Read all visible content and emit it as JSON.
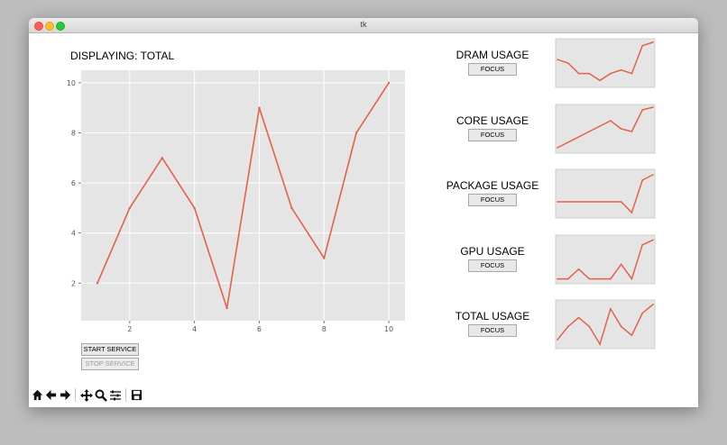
{
  "window": {
    "title": "tk"
  },
  "main": {
    "heading": "DISPLAYING: TOTAL",
    "start_button": "START SERVICE",
    "stop_button": "STOP SERVICE"
  },
  "panels": [
    {
      "label": "DRAM USAGE",
      "button": "FOCUS"
    },
    {
      "label": "CORE USAGE",
      "button": "FOCUS"
    },
    {
      "label": "PACKAGE USAGE",
      "button": "FOCUS"
    },
    {
      "label": "GPU USAGE",
      "button": "FOCUS"
    },
    {
      "label": "TOTAL USAGE",
      "button": "FOCUS"
    }
  ],
  "toolbar": [
    "home-icon",
    "back-arrow-icon",
    "forward-arrow-icon",
    "pan-icon",
    "zoom-icon",
    "configure-icon",
    "save-icon"
  ],
  "colors": {
    "line": "#e2634a",
    "plot_bg": "#e5e5e5",
    "grid": "#ffffff"
  },
  "chart_data": [
    {
      "type": "line",
      "x": [
        1,
        2,
        3,
        4,
        5,
        6,
        7,
        8,
        9,
        10
      ],
      "series": [
        {
          "values": [
            2,
            5,
            7,
            5,
            1,
            9,
            5,
            3,
            8,
            10
          ]
        }
      ],
      "xticks": [
        2,
        4,
        6,
        8,
        10
      ],
      "yticks": [
        2,
        4,
        6,
        8,
        10
      ],
      "xlim": [
        0.5,
        10.5
      ],
      "ylim": [
        0.5,
        10.5
      ],
      "grid": true
    },
    {
      "type": "line",
      "panel": "DRAM USAGE",
      "x": [
        1,
        2,
        3,
        4,
        5,
        6,
        7,
        8,
        9,
        10
      ],
      "series": [
        {
          "values": [
            6,
            5.5,
            4,
            4,
            3,
            4,
            4.5,
            4,
            8,
            8.5
          ]
        }
      ],
      "ylim": [
        2,
        9
      ]
    },
    {
      "type": "line",
      "panel": "CORE USAGE",
      "x": [
        1,
        2,
        3,
        4,
        5,
        6,
        7,
        8,
        9,
        10
      ],
      "series": [
        {
          "values": [
            1,
            2,
            3,
            4,
            5,
            6,
            4.5,
            4,
            8,
            8.5
          ]
        }
      ],
      "ylim": [
        0,
        9
      ]
    },
    {
      "type": "line",
      "panel": "PACKAGE USAGE",
      "x": [
        1,
        2,
        3,
        4,
        5,
        6,
        7,
        8,
        9,
        10
      ],
      "series": [
        {
          "values": [
            4,
            4,
            4,
            4,
            4,
            4,
            4,
            2,
            8,
            9
          ]
        }
      ],
      "ylim": [
        1,
        10
      ]
    },
    {
      "type": "line",
      "panel": "GPU USAGE",
      "x": [
        1,
        2,
        3,
        4,
        5,
        6,
        7,
        8,
        9,
        10
      ],
      "series": [
        {
          "values": [
            1,
            1,
            3,
            1,
            1,
            1,
            4,
            1,
            8,
            9
          ]
        }
      ],
      "ylim": [
        0,
        10
      ]
    },
    {
      "type": "line",
      "panel": "TOTAL USAGE",
      "x": [
        1,
        2,
        3,
        4,
        5,
        6,
        7,
        8,
        9,
        10
      ],
      "series": [
        {
          "values": [
            2,
            5,
            7,
            5,
            1,
            9,
            5,
            3,
            8,
            10
          ]
        }
      ],
      "ylim": [
        0,
        11
      ]
    }
  ]
}
